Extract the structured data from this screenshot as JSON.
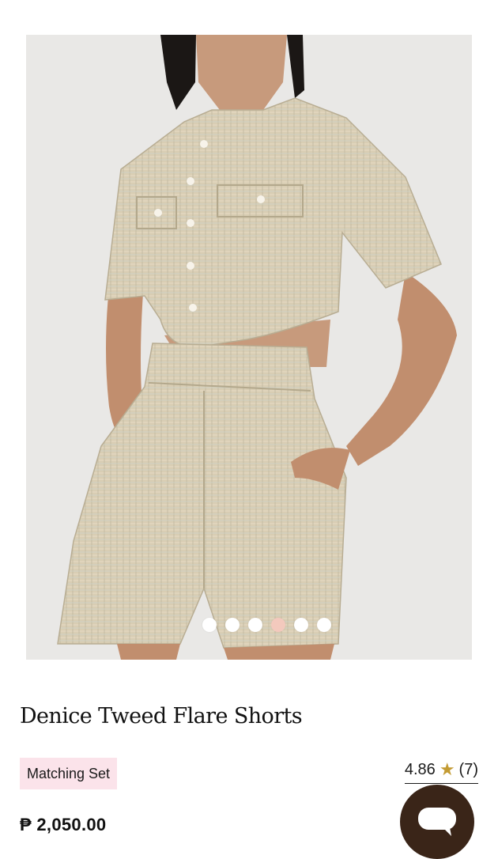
{
  "product": {
    "title": "Denice Tweed Flare Shorts",
    "tag": "Matching Set",
    "price": "₱ 2,050.00",
    "rating": "4.86",
    "rating_star": "★",
    "review_count": "(7)"
  },
  "gallery": {
    "image_description": "Model wearing tweed cropped jacket and matching tweed shorts",
    "dot_count": 6,
    "active_dot": 4
  },
  "colors": {
    "tag_bg": "#fbe3ea",
    "star": "#c39b33",
    "chat_button": "#3a2518",
    "active_dot": "#f3c9bd"
  },
  "icons": {
    "chat": "chat-bubble-icon"
  }
}
